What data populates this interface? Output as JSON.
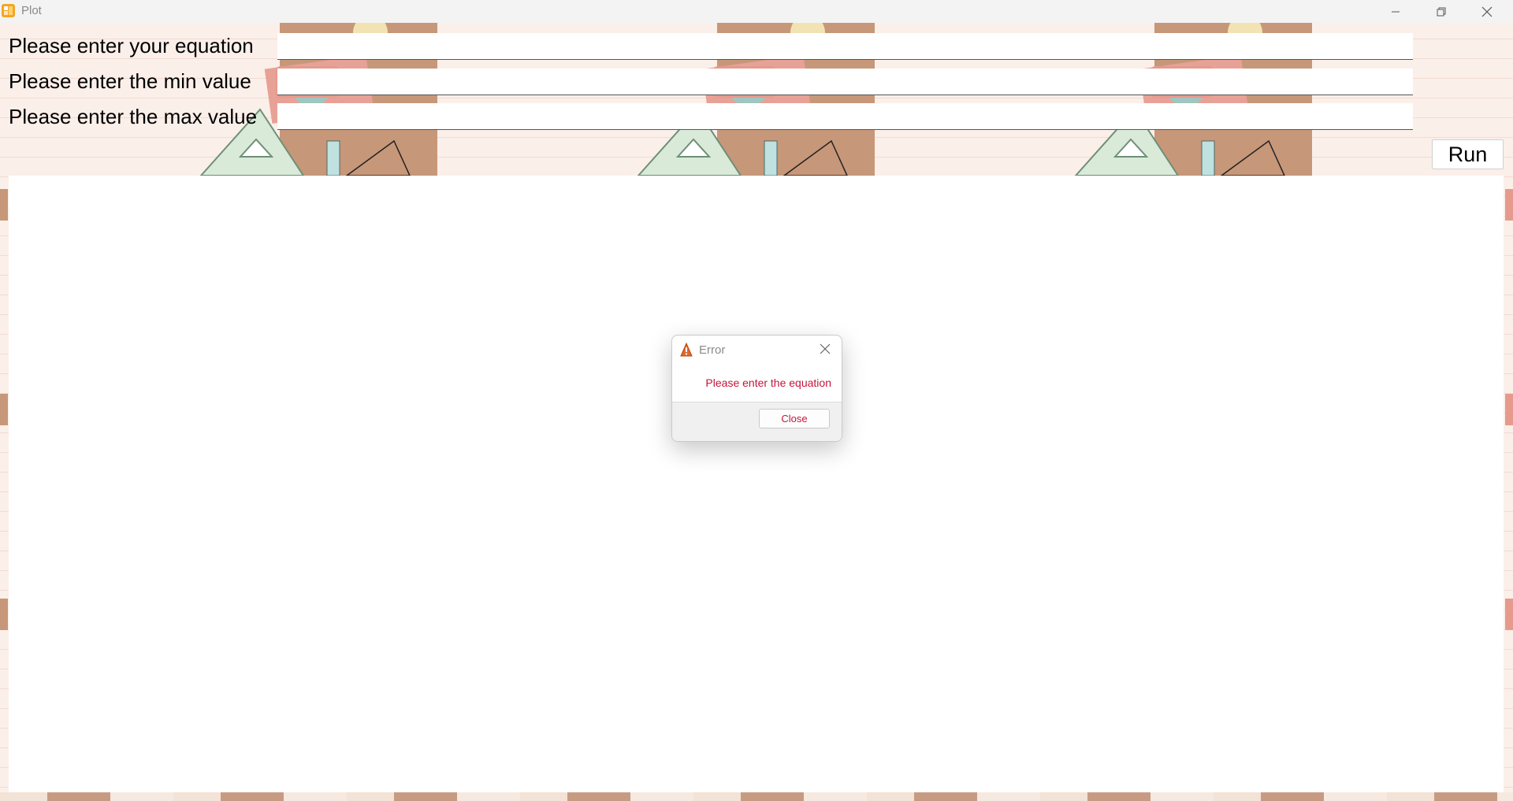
{
  "window": {
    "title": "Plot",
    "icon": "plot-app-icon",
    "controls": [
      "minimize-icon",
      "restore-icon",
      "close-icon"
    ]
  },
  "form": {
    "equation_label": "Please enter your equation",
    "equation_value": "",
    "min_label": "Please enter the min value",
    "min_value": "",
    "max_label": "Please enter the max value",
    "max_value": "",
    "run_label": "Run"
  },
  "dialog": {
    "title": "Error",
    "icon": "warning-icon",
    "message": "Please enter the equation",
    "close_label": "Close"
  },
  "colors": {
    "background": "#fbefe9",
    "dialog_text": "#c4153a",
    "title_text": "#8a8a8a"
  }
}
